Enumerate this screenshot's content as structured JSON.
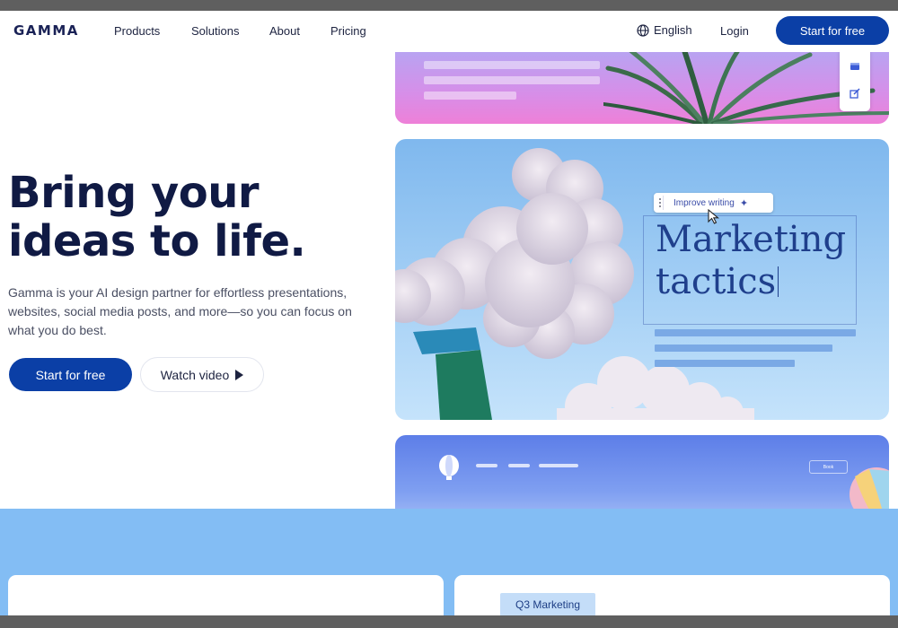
{
  "nav": {
    "logo": "GAMMA",
    "links": [
      "Products",
      "Solutions",
      "About",
      "Pricing"
    ],
    "language": "English",
    "login": "Login",
    "cta": "Start for free"
  },
  "hero": {
    "title_line1": "Bring your",
    "title_line2": "ideas to life.",
    "subtitle": "Gamma is your AI design partner for effortless presentations, websites, social media posts, and more—so you can focus on what you do best.",
    "primary_button": "Start for free",
    "secondary_button": "Watch video"
  },
  "preview": {
    "toolbar_label": "Improve writing",
    "card_title_line1": "Marketing",
    "card_title_line2": "tactics",
    "card3_button": "Book"
  },
  "bottom": {
    "chip_label": "Q3 Marketing"
  },
  "colors": {
    "brand_blue": "#0b3fa6",
    "heading_navy": "#101a44",
    "band_blue": "#83bdf4"
  },
  "icons": [
    "globe-icon",
    "play-icon",
    "drag-handle-icon",
    "sparkle-icon",
    "cursor-icon",
    "card-layout-icon",
    "edit-icon",
    "balloon-icon"
  ]
}
